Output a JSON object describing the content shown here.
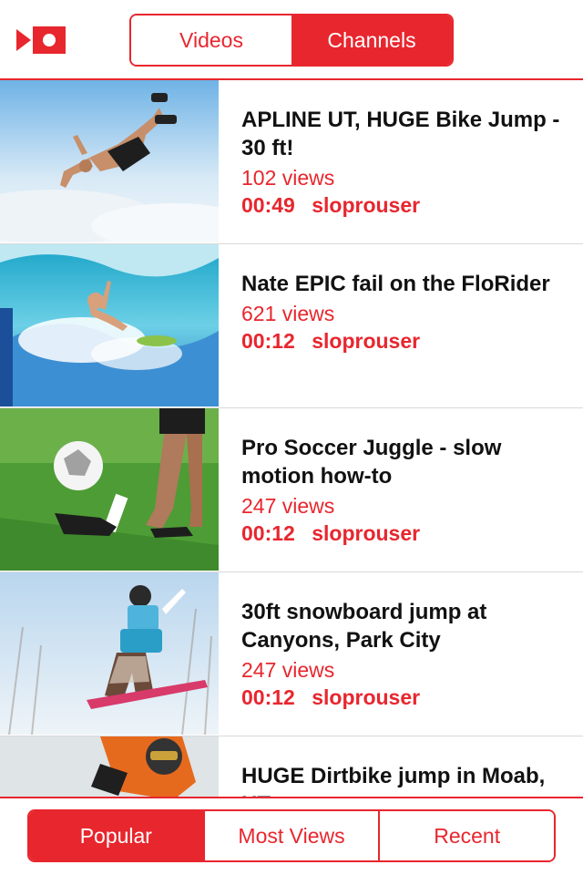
{
  "app": {
    "logo_icon": "video-camera-logo-icon",
    "accent": "#e8262e"
  },
  "top_tabs": {
    "videos": "Videos",
    "channels": "Channels",
    "active": "Channels"
  },
  "videos": [
    {
      "title": "APLINE UT, HUGE Bike Jump - 30 ft!",
      "views": "102 views",
      "duration": "00:49",
      "user": "sloprouser"
    },
    {
      "title": "Nate EPIC fail on the FloRider",
      "views": "621 views",
      "duration": "00:12",
      "user": "sloprouser"
    },
    {
      "title": "Pro Soccer Juggle - slow motion how-to",
      "views": "247 views",
      "duration": "00:12",
      "user": "sloprouser"
    },
    {
      "title": "30ft snowboard jump at Canyons, Park City",
      "views": "247 views",
      "duration": "00:12",
      "user": "sloprouser"
    },
    {
      "title": "HUGE Dirtbike jump in Moab, UT",
      "views": "",
      "duration": "",
      "user": ""
    }
  ],
  "bottom_tabs": {
    "popular": "Popular",
    "most_views": "Most Views",
    "recent": "Recent",
    "active": "Popular"
  }
}
